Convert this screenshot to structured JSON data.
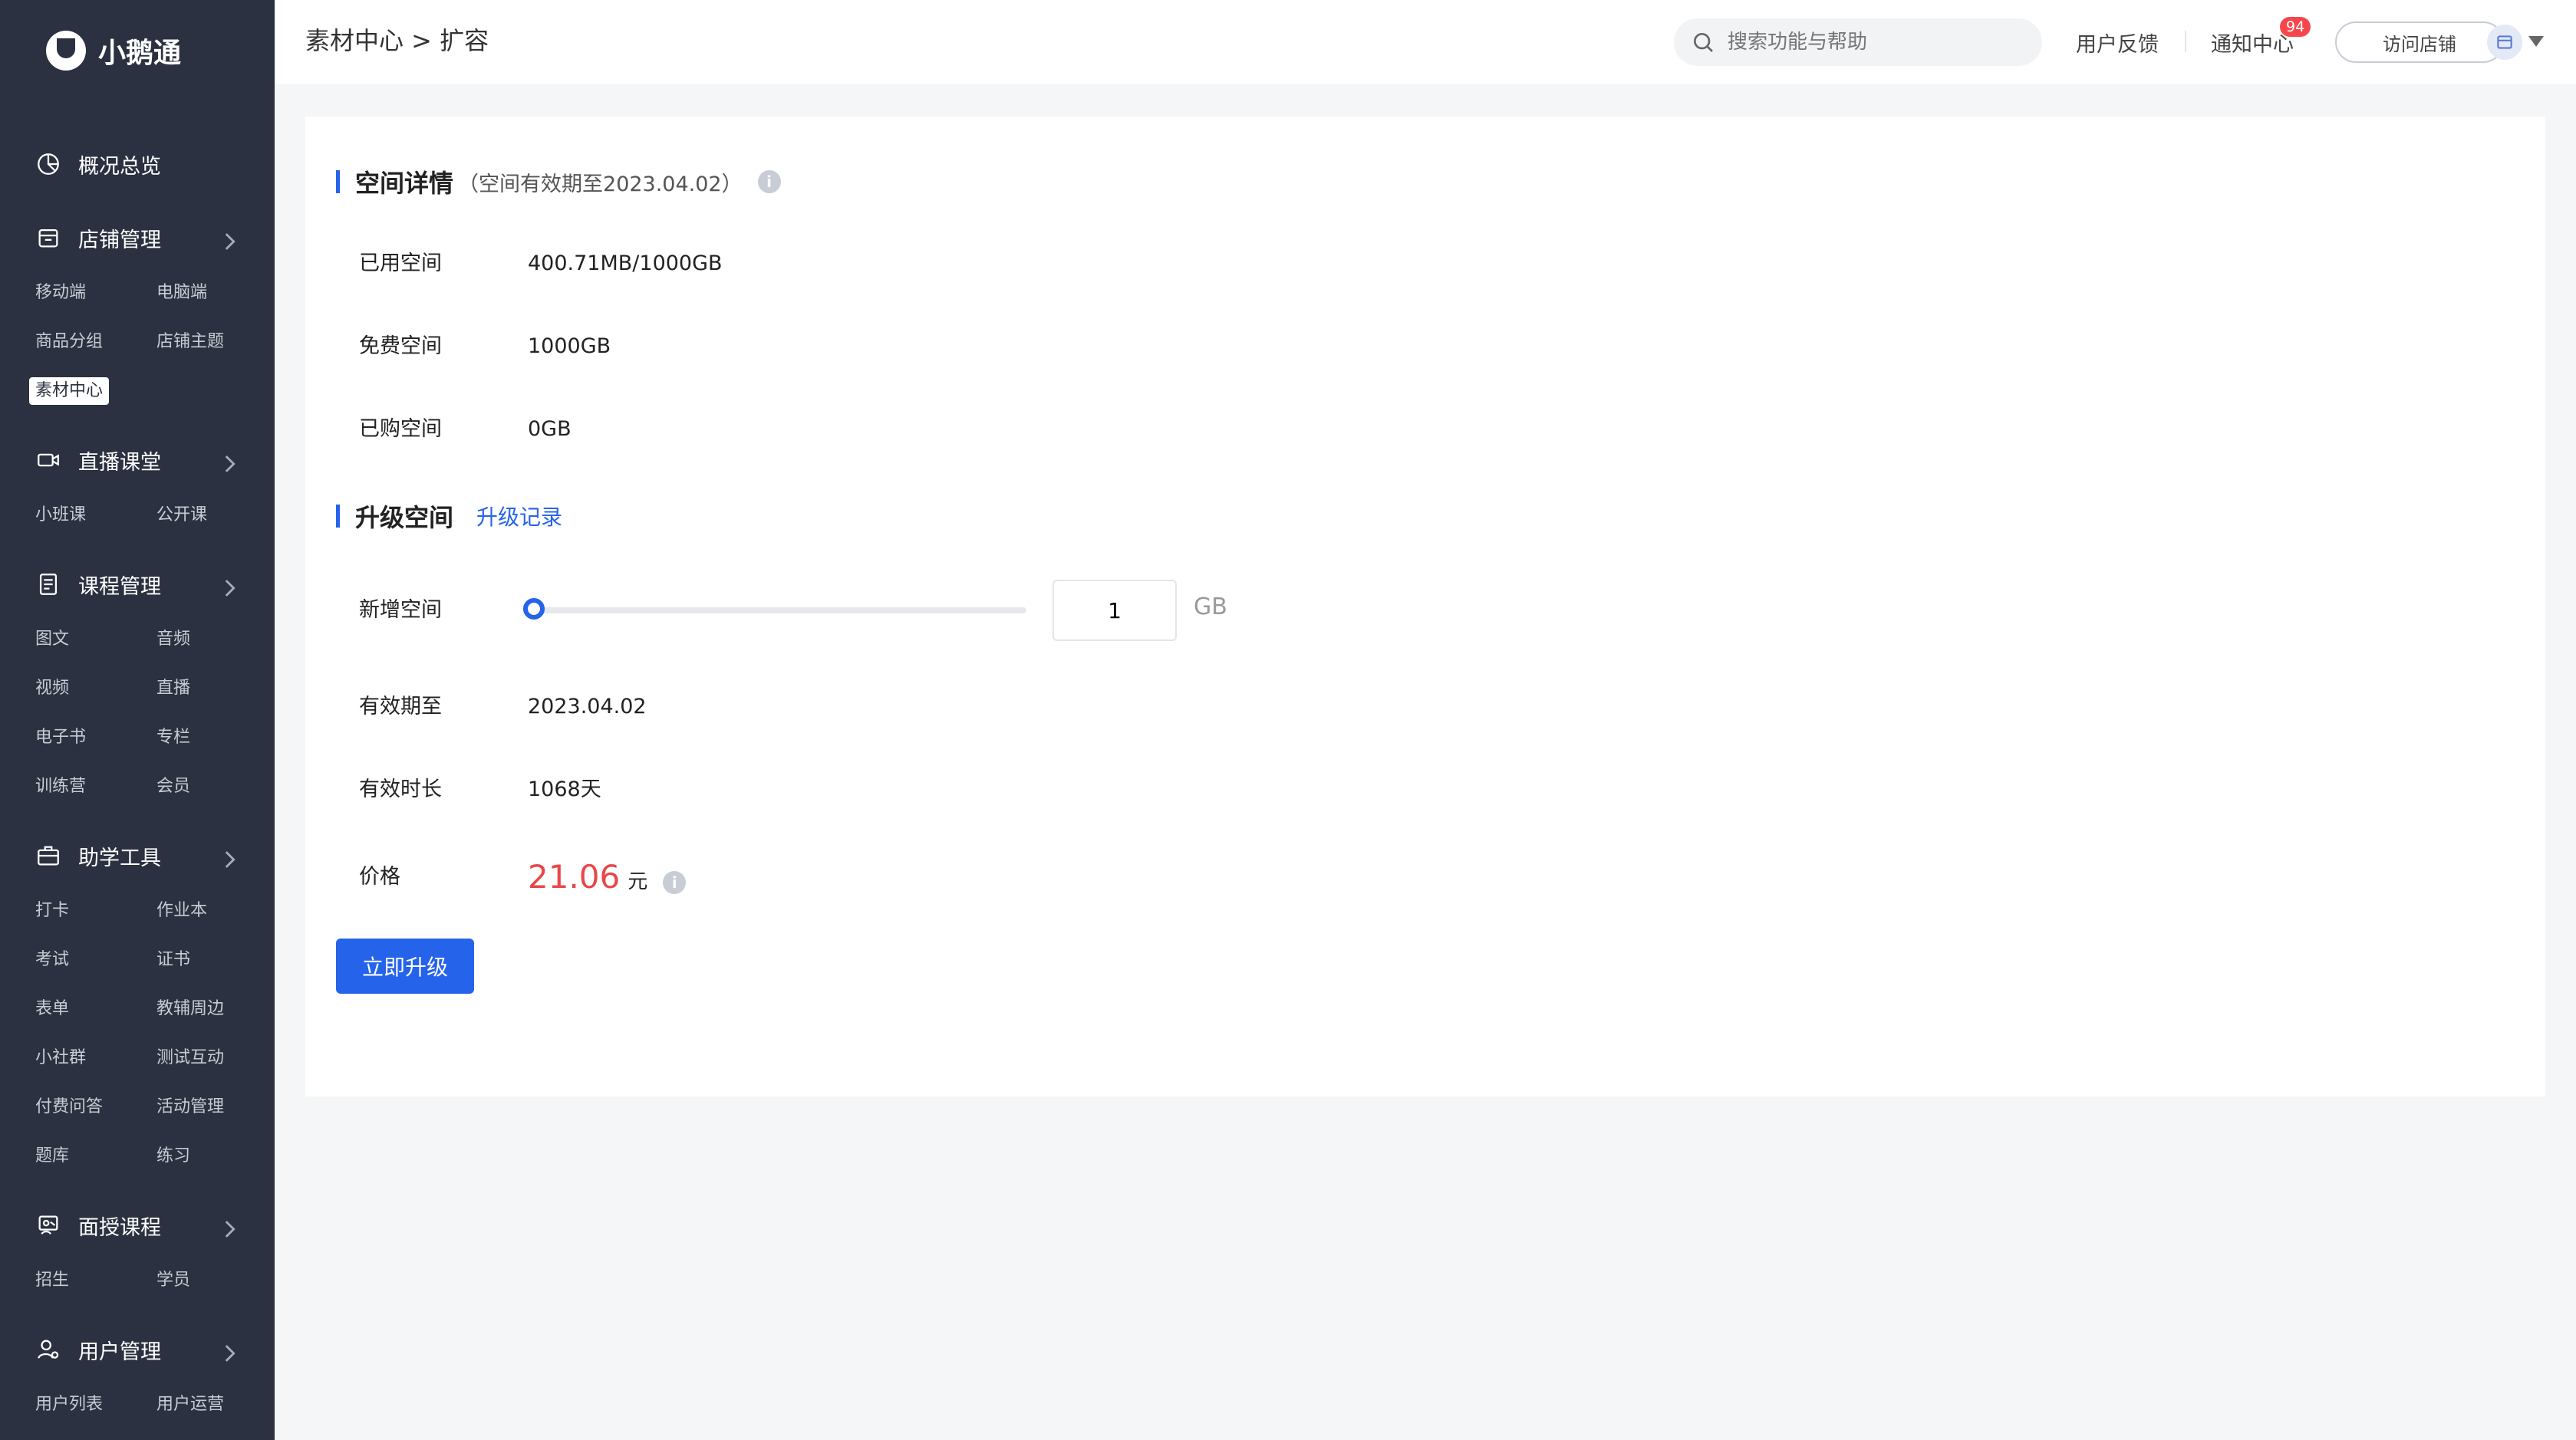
{
  "brand": {
    "name": "小鹅通"
  },
  "sidebar": {
    "overview": "概况总览",
    "groups": [
      {
        "title": "店铺管理",
        "items": [
          "移动端",
          "电脑端",
          "商品分组",
          "店铺主题",
          "素材中心"
        ]
      },
      {
        "title": "直播课堂",
        "items": [
          "小班课",
          "公开课"
        ]
      },
      {
        "title": "课程管理",
        "items": [
          "图文",
          "音频",
          "视频",
          "直播",
          "电子书",
          "专栏",
          "训练营",
          "会员"
        ]
      },
      {
        "title": "助学工具",
        "items": [
          "打卡",
          "作业本",
          "考试",
          "证书",
          "表单",
          "教辅周边",
          "小社群",
          "测试互动",
          "付费问答",
          "活动管理",
          "题库",
          "练习"
        ]
      },
      {
        "title": "面授课程",
        "items": [
          "招生",
          "学员"
        ]
      },
      {
        "title": "用户管理",
        "items": [
          "用户列表",
          "用户运营"
        ]
      }
    ],
    "active_item": "素材中心"
  },
  "header": {
    "breadcrumb": "素材中心 > 扩容",
    "search_placeholder": "搜索功能与帮助",
    "feedback": "用户反馈",
    "notifications": "通知中心",
    "notification_count": "94",
    "visit_store": "访问店铺"
  },
  "space": {
    "title": "空间详情",
    "note": "（空间有效期至2023.04.02）",
    "used_label": "已用空间",
    "used_value": "400.71MB/1000GB",
    "free_label": "免费空间",
    "free_value": "1000GB",
    "bought_label": "已购空间",
    "bought_value": "0GB"
  },
  "upgrade": {
    "title": "升级空间",
    "history_link": "升级记录",
    "add_label": "新增空间",
    "add_value": "1",
    "add_unit": "GB",
    "slider_fraction": 0,
    "expire_label": "有效期至",
    "expire_value": "2023.04.02",
    "duration_label": "有效时长",
    "duration_value": "1068天",
    "price_label": "价格",
    "price_value": "21.06",
    "price_unit": "元",
    "button": "立即升级"
  },
  "colors": {
    "sidebar_bg": "#2b3140",
    "accent": "#2563eb",
    "price": "#e8474a",
    "badge": "#f5474b"
  }
}
